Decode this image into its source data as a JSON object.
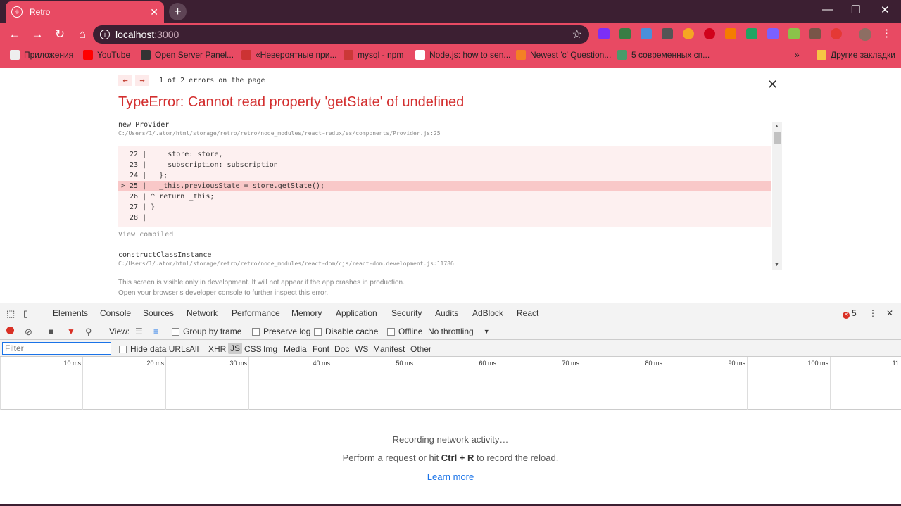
{
  "tab": {
    "title": "Retro"
  },
  "address": {
    "host": "localhost",
    "port": ":3000"
  },
  "bookmarks": [
    {
      "label": "Приложения",
      "color": "#e8e8e8"
    },
    {
      "label": "YouTube",
      "color": "#ff0000"
    },
    {
      "label": "Open Server Panel...",
      "color": "#333333"
    },
    {
      "label": "«Невероятные при...",
      "color": "#cc3333"
    },
    {
      "label": "mysql - npm",
      "color": "#cb3837"
    },
    {
      "label": "Node.js: how to sen...",
      "color": "#ffffff"
    },
    {
      "label": "Newest 'c' Question...",
      "color": "#f48024"
    },
    {
      "label": "5 современных сп...",
      "color": "#4a9a6a"
    }
  ],
  "bookmarks_other": "Другие закладки",
  "overlay": {
    "nav_prev": "←",
    "nav_next": "→",
    "error_count": "1 of 2 errors on the page",
    "headline": "TypeError: Cannot read property 'getState' of undefined",
    "frame1_fn": "new Provider",
    "frame1_path": "C:/Users/1/.atom/html/storage/retro/retro/node_modules/react-redux/es/components/Provider.js:25",
    "code_lines": [
      "  22 |     store: store,",
      "  23 |     subscription: subscription",
      "  24 |   };",
      "> 25 |   _this.previousState = store.getState();",
      "  26 | ^ return _this;",
      "  27 | }",
      "  28 |"
    ],
    "view_compiled": "View compiled",
    "frame2_fn": "constructClassInstance",
    "frame2_path": "C:/Users/1/.atom/html/storage/retro/retro/node_modules/react-dom/cjs/react-dom.development.js:11786",
    "footnote1": "This screen is visible only in development. It will not appear if the app crashes in production.",
    "footnote2": "Open your browser’s developer console to further inspect this error."
  },
  "devtools": {
    "tabs": [
      "Elements",
      "Console",
      "Sources",
      "Network",
      "Performance",
      "Memory",
      "Application",
      "Security",
      "Audits",
      "AdBlock",
      "React"
    ],
    "active_tab": "Network",
    "error_badge": "5",
    "view_label": "View:",
    "group_by_frame": "Group by frame",
    "preserve_log": "Preserve log",
    "disable_cache": "Disable cache",
    "offline": "Offline",
    "throttling": "No throttling",
    "filter_placeholder": "Filter",
    "hide_data_urls": "Hide data URLs",
    "types": [
      "All",
      "XHR",
      "JS",
      "CSS",
      "Img",
      "Media",
      "Font",
      "Doc",
      "WS",
      "Manifest",
      "Other"
    ],
    "ticks": [
      "10 ms",
      "20 ms",
      "30 ms",
      "40 ms",
      "50 ms",
      "60 ms",
      "70 ms",
      "80 ms",
      "90 ms",
      "100 ms",
      "11"
    ],
    "recording": "Recording network activity…",
    "perform_prefix": "Perform a request or hit ",
    "perform_keys": "Ctrl + R",
    "perform_suffix": " to record the reload.",
    "learn_more": "Learn more"
  },
  "colors": {
    "accent": "#e84a63",
    "frame": "#3c1f32",
    "error": "#d32f2f"
  }
}
